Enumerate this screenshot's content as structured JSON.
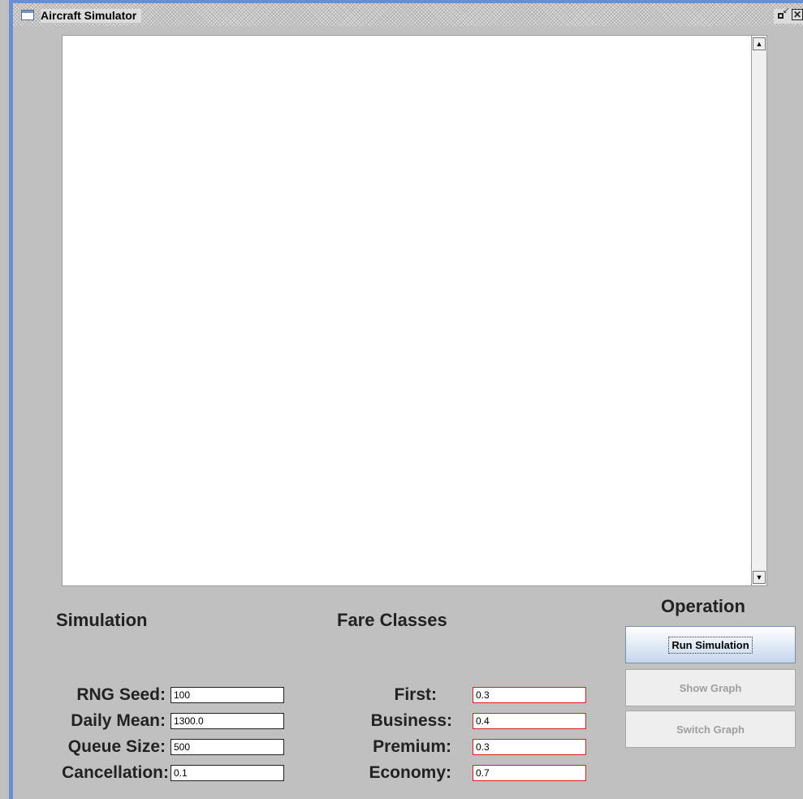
{
  "window": {
    "title": "Aircraft Simulator",
    "close_glyph": "✕",
    "accent_color": "#6a8ecf"
  },
  "output": {
    "text": ""
  },
  "simulation": {
    "title": "Simulation",
    "fields": [
      {
        "label": "RNG Seed:",
        "value": "100"
      },
      {
        "label": "Daily Mean:",
        "value": "1300.0"
      },
      {
        "label": "Queue Size:",
        "value": "500"
      },
      {
        "label": "Cancellation:",
        "value": "0.1"
      }
    ]
  },
  "fare_classes": {
    "title": "Fare Classes",
    "fields": [
      {
        "label": "First:",
        "value": "0.3"
      },
      {
        "label": "Business:",
        "value": "0.4"
      },
      {
        "label": "Premium:",
        "value": "0.3"
      },
      {
        "label": "Economy:",
        "value": "0.7"
      }
    ],
    "invalid_border_color": "#d82020"
  },
  "operation": {
    "title": "Operation",
    "run_label": "Run Simulation",
    "show_graph_label": "Show Graph",
    "switch_graph_label": "Switch Graph"
  },
  "icons": {
    "app": "window-icon",
    "restore": "restore-icon",
    "close": "close-icon",
    "scroll_up": "arrow-up-icon",
    "scroll_down": "arrow-down-icon"
  }
}
